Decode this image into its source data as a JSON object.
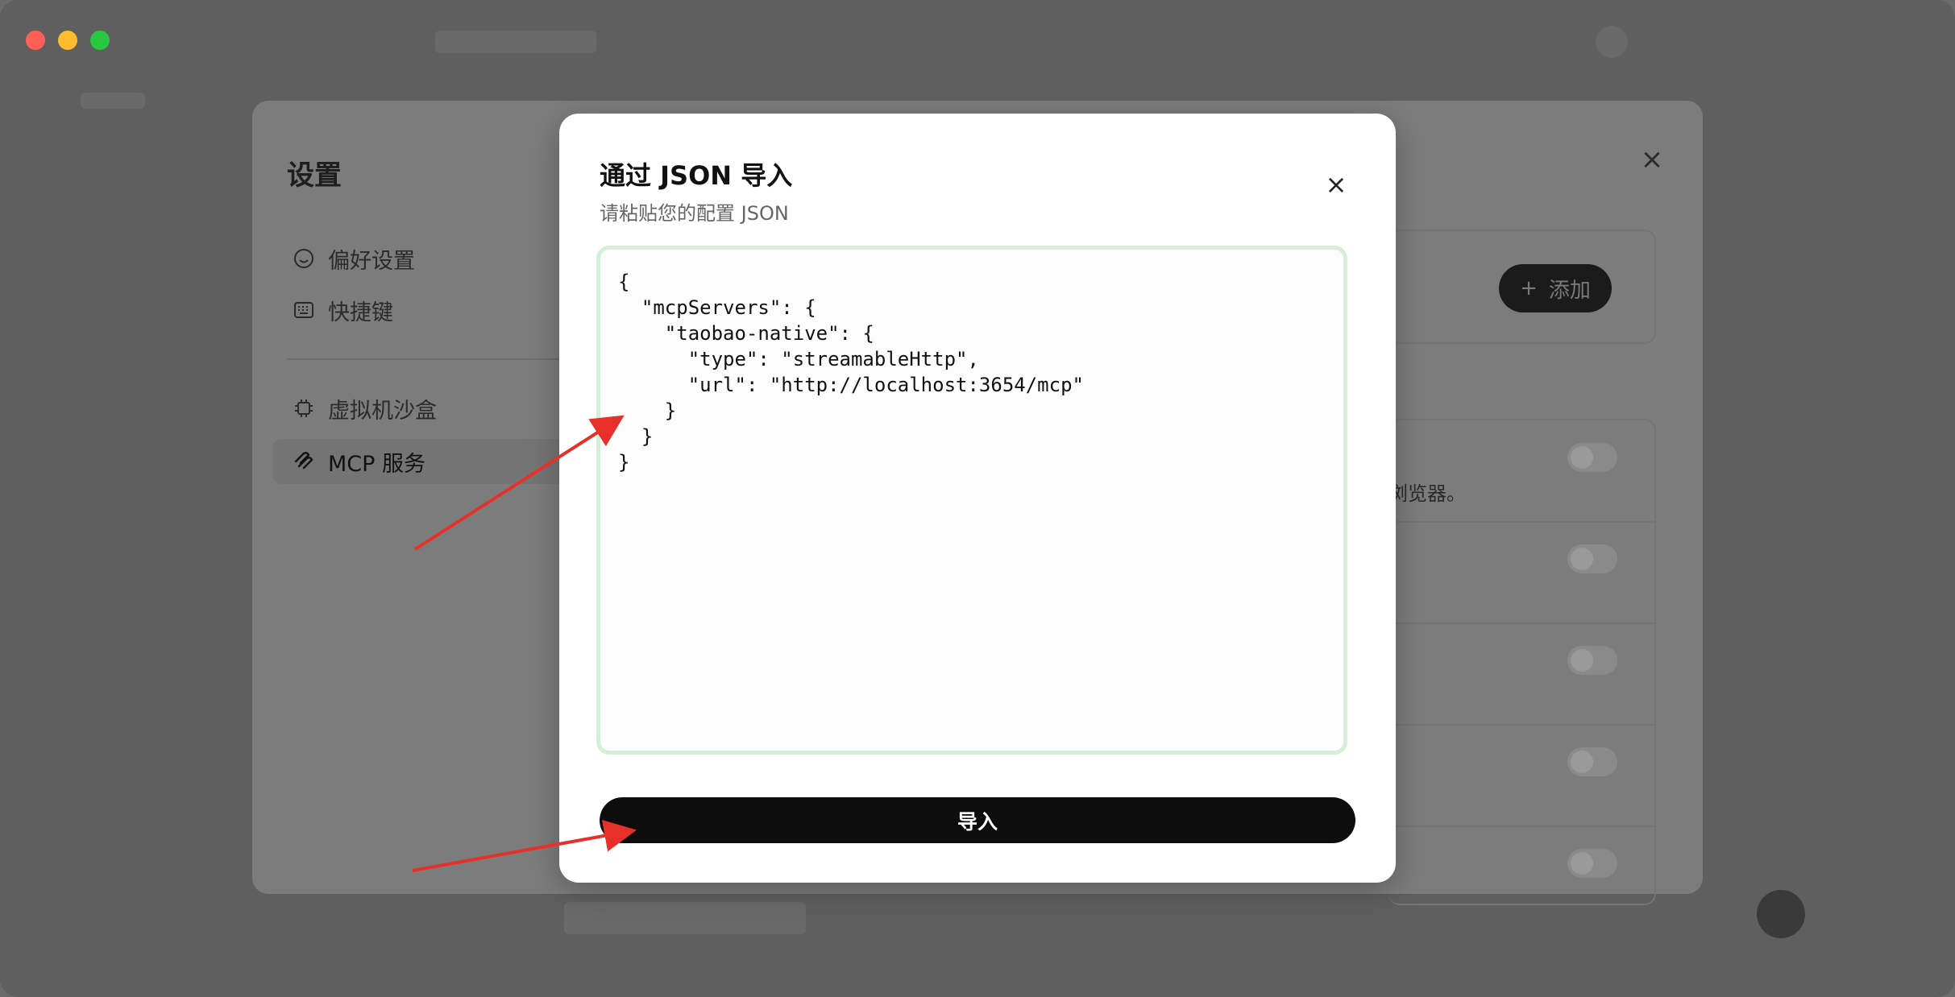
{
  "window": {
    "traffic_lights": [
      "close",
      "minimize",
      "maximize"
    ]
  },
  "settings": {
    "title": "设置",
    "nav": [
      {
        "label": "偏好设置",
        "icon": "smile-icon"
      },
      {
        "label": "快捷键",
        "icon": "keyboard-icon"
      },
      {
        "label": "虚拟机沙盒",
        "icon": "chip-icon"
      },
      {
        "label": "MCP 服务",
        "icon": "mcp-icon"
      }
    ],
    "active_nav": "MCP 服务",
    "add_button_label": "添加",
    "row_description_fragment": "浏览器。"
  },
  "modal": {
    "title": "通过 JSON 导入",
    "subtitle": "请粘贴您的配置 JSON",
    "json_value": "{\n  \"mcpServers\": {\n    \"taobao-native\": {\n      \"type\": \"streamableHttp\",\n      \"url\": \"http://localhost:3654/mcp\"\n    }\n  }\n}",
    "import_button_label": "导入"
  },
  "colors": {
    "annotation_arrow": "#e8302a",
    "json_box_border": "#d6eed8",
    "import_button_bg": "#0d0d0d"
  }
}
